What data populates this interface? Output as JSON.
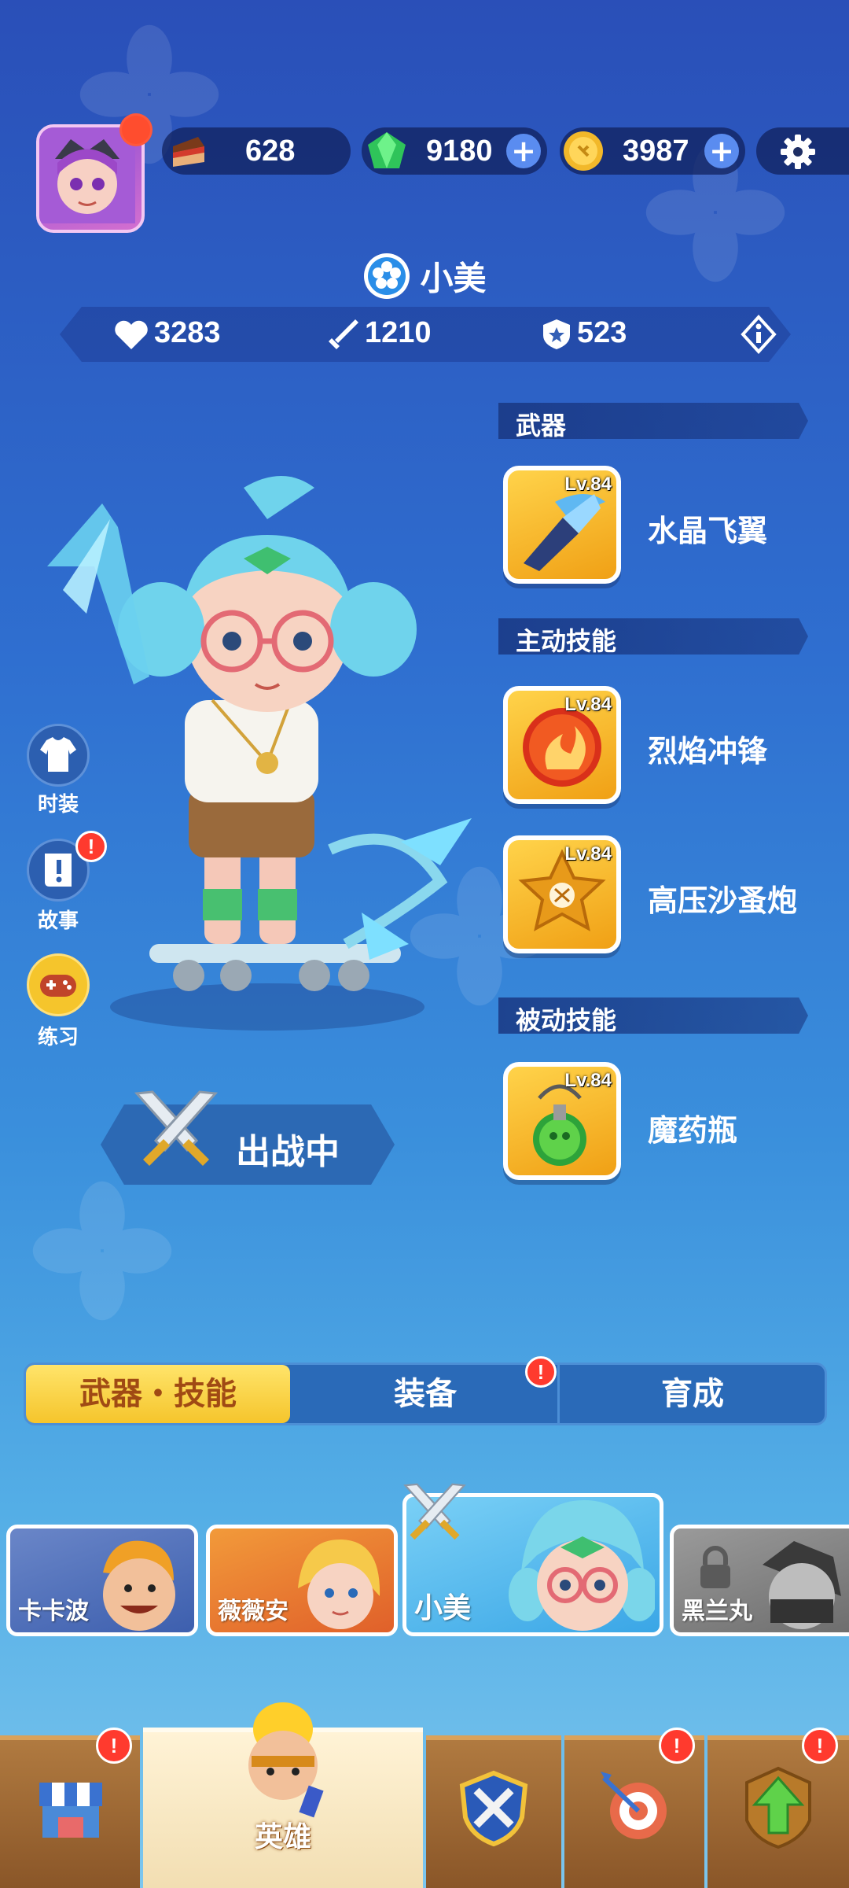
{
  "resources": {
    "cake": "628",
    "gems": "9180",
    "coins": "3987",
    "plus_symbol": "+"
  },
  "hero": {
    "name": "小美",
    "stats": {
      "hp": "3283",
      "attack": "1210",
      "defense": "523"
    }
  },
  "sections": {
    "weapon": {
      "title": "武器",
      "items": [
        {
          "name": "水晶飞翼",
          "level": "Lv.84"
        }
      ]
    },
    "active": {
      "title": "主动技能",
      "items": [
        {
          "name": "烈焰冲锋",
          "level": "Lv.84"
        },
        {
          "name": "高压沙蚤炮",
          "level": "Lv.84"
        }
      ]
    },
    "passive": {
      "title": "被动技能",
      "items": [
        {
          "name": "魔药瓶",
          "level": "Lv.84"
        }
      ]
    }
  },
  "side_buttons": [
    {
      "label": "时装",
      "icon": "shirt-icon"
    },
    {
      "label": "故事",
      "icon": "story-icon"
    },
    {
      "label": "练习",
      "icon": "gamepad-icon"
    }
  ],
  "alert_symbol": "!",
  "deploy_label": "出战中",
  "tabs": [
    {
      "label": "武器・技能",
      "active": true
    },
    {
      "label": "装备",
      "active": false
    },
    {
      "label": "育成",
      "active": false
    }
  ],
  "heroes": [
    {
      "name": "卡卡波"
    },
    {
      "name": "薇薇安"
    },
    {
      "name": "小美"
    },
    {
      "name": "黑兰丸"
    }
  ],
  "nav": {
    "active_label": "英雄"
  },
  "colors": {
    "accent_yellow": "#f5c52c",
    "alert_red": "#ff3a2e",
    "panel_blue": "#2a6ab8"
  }
}
